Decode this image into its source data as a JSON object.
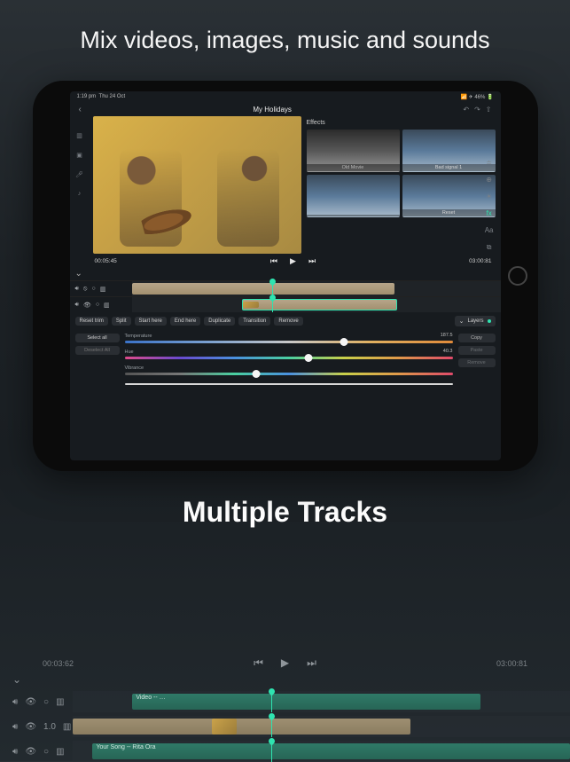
{
  "promo": {
    "headline": "Mix videos, images, music and sounds",
    "subheadline": "Multiple Tracks"
  },
  "statusbar": {
    "time": "1:19 pm",
    "date": "Thu 24 Oct",
    "battery": "46%"
  },
  "titlebar": {
    "project_title": "My Holidays"
  },
  "transport": {
    "current_time": "00:05:45",
    "total_time": "03:00:81"
  },
  "effects": {
    "panel_label": "Effects",
    "tiles": [
      {
        "label": "Old Movie"
      },
      {
        "label": "Bad signal 1"
      },
      {
        "label": ""
      },
      {
        "label": "Reset"
      }
    ],
    "fx_badge": "fx",
    "aa_badge": "Aa"
  },
  "edit_buttons": {
    "reset_trim": "Reset trim",
    "split": "Split",
    "start_here": "Start here",
    "end_here": "End here",
    "duplicate": "Duplicate",
    "transition": "Transition",
    "remove": "Remove",
    "layers": "Layers"
  },
  "select": {
    "select_all": "Select all",
    "deselect_all": "Deselect All"
  },
  "actions": {
    "copy": "Copy",
    "paste": "Paste",
    "remove": "Remove"
  },
  "sliders": {
    "temperature": {
      "label": "Temperature",
      "value": "187.5",
      "pos": 0.67
    },
    "hue": {
      "label": "Hue",
      "value": "40.3",
      "pos": 0.56
    },
    "vibrance": {
      "label": "Vibrance",
      "value": "",
      "pos": 0.4
    }
  },
  "ghost": {
    "current_time": "00:03:62",
    "total_time": "03:00:81",
    "clip_video": "Video -- …",
    "clip_song": "Your Song -- Rita Ora",
    "opacity_label": "1.0"
  }
}
